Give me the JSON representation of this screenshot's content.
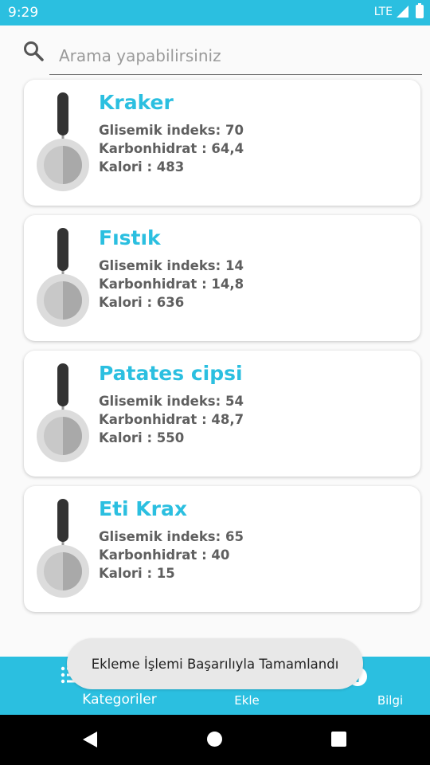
{
  "theme": {
    "accent": "#2bbfe0",
    "title_color": "#2bbfe0",
    "bottom_nav": "#2bbfe0"
  },
  "status_bar": {
    "time": "9:29",
    "network": "LTE"
  },
  "search": {
    "placeholder": "Arama yapabilirsiniz",
    "value": ""
  },
  "items": [
    {
      "name": "Kraker",
      "glycemic_index": "Glisemik indeks: 70",
      "carbohydrate": "Karbonhidrat : 64,4",
      "calorie": "Kalori : 483",
      "icon": "pan-icon"
    },
    {
      "name": "Fıstık",
      "glycemic_index": "Glisemik indeks: 14",
      "carbohydrate": "Karbonhidrat : 14,8",
      "calorie": "Kalori : 636",
      "icon": "pan-icon"
    },
    {
      "name": "Patates cipsi",
      "glycemic_index": "Glisemik indeks: 54",
      "carbohydrate": "Karbonhidrat : 48,7",
      "calorie": "Kalori : 550",
      "icon": "pan-icon"
    },
    {
      "name": "Eti Krax",
      "glycemic_index": "Glisemik indeks: 65",
      "carbohydrate": "Karbonhidrat : 40",
      "calorie": "Kalori : 15",
      "icon": "pan-icon"
    }
  ],
  "toast": {
    "message": "Ekleme İşlemi Başarılıyla Tamamlandı"
  },
  "bottom_nav": {
    "categories_label": "Kategoriler",
    "add_label": "Ekle",
    "info_label": "Bilgi"
  }
}
